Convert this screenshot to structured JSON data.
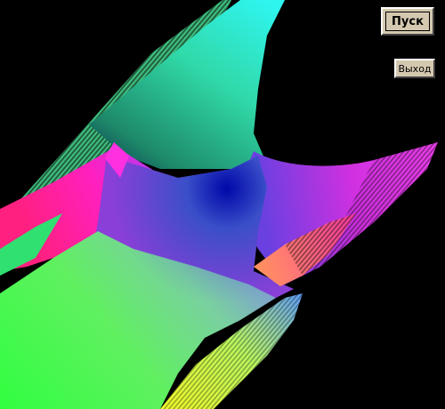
{
  "window": {
    "background": "#000000"
  },
  "render": {
    "description_colors": [
      "#00ff00",
      "#ff00ff",
      "#00ffff",
      "#0000ff",
      "#ffff00",
      "#ff0000"
    ]
  },
  "controls": {
    "start_label": "Пуск",
    "exit_label": "Выход"
  }
}
